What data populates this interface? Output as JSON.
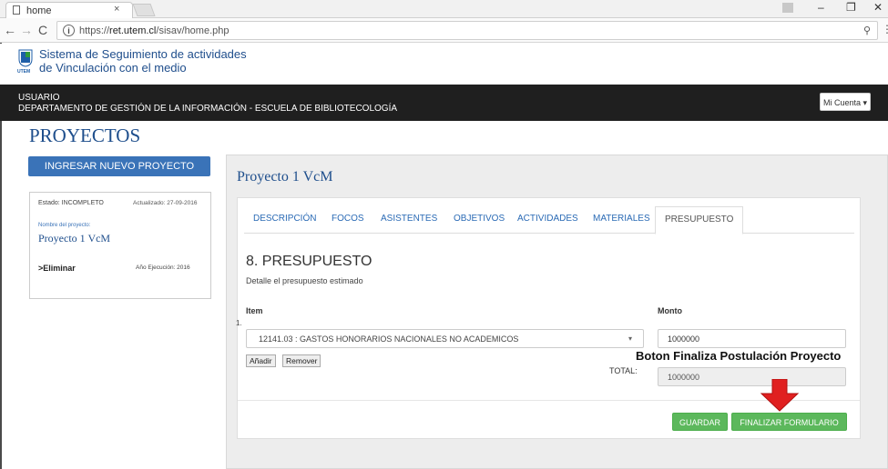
{
  "browser": {
    "tab_title": "home",
    "tab_close": "×",
    "url_scheme": "https://",
    "url_host": "ret.utem.cl",
    "url_path": "/sisav/home.php",
    "icons": [
      "document-icon",
      "back-arrow-icon",
      "forward-arrow-icon",
      "reload-icon",
      "info-icon",
      "extension-icon",
      "menu-icon"
    ],
    "window_controls": [
      "–",
      "❐",
      "✕"
    ]
  },
  "site": {
    "title_line1": "Sistema de Seguimiento de actividades",
    "title_line2": "de Vinculación con el medio",
    "logo_text": "UTEM",
    "brand_color": "#1e4e8c"
  },
  "user_bar": {
    "user": "USUARIO",
    "department": "DEPARTAMENTO DE GESTIÓN DE LA INFORMACIÓN - ESCUELA DE BIBLIOTECOLOGÍA",
    "account_button": "Mi Cuenta ▾"
  },
  "page": {
    "title": "PROYECTOS",
    "new_project_button": "INGRESAR NUEVO PROYECTO"
  },
  "project_card": {
    "estado": "Estado: INCOMPLETO",
    "updated": "Actualizado: 27-09-2016",
    "name_label": "Nombre del proyecto:",
    "name": "Proyecto 1 VcM",
    "delete": ">Eliminar",
    "year": "Año Ejecución: 2016"
  },
  "main": {
    "title": "Proyecto 1 VcM",
    "tabs": [
      "DESCRIPCIÓN",
      "FOCOS",
      "ASISTENTES",
      "OBJETIVOS",
      "ACTIVIDADES",
      "MATERIALES",
      "PRESUPUESTO"
    ],
    "active_tab": "PRESUPUESTO",
    "section_title": "8. PRESUPUESTO",
    "section_subtitle": "Detalle el presupuesto estimado",
    "col_item": "Item",
    "col_monto": "Monto",
    "row_number": "1.",
    "item_selected": "12141.03 : GASTOS HONORARIOS NACIONALES NO ACADEMICOS",
    "monto_value": "1000000",
    "add_button": "Añadir",
    "remove_button": "Remover",
    "total_label": "TOTAL:",
    "total_value": "1000000",
    "save_button": "GUARDAR",
    "finalize_button": "FINALIZAR FORMULARIO"
  },
  "annotation": {
    "text": "Boton Finaliza Postulación Proyecto",
    "arrow_color": "#e02020"
  }
}
